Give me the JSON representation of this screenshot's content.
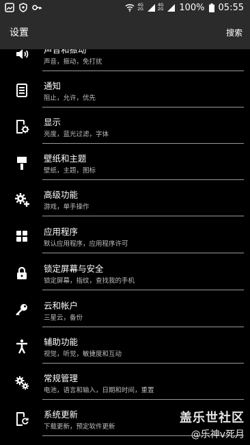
{
  "status_bar": {
    "network_top": "4G",
    "network_bottom": "2G",
    "network2_top": "4G",
    "network2_bottom": "2G",
    "battery": "100%",
    "time": "05:55"
  },
  "header": {
    "title": "设置",
    "search": "搜索"
  },
  "items": [
    {
      "title": "声音和振动",
      "subtitle": "声音，振动，免打扰",
      "icon": "speaker-icon"
    },
    {
      "title": "通知",
      "subtitle": "阻止，允许，优先",
      "icon": "notification-icon"
    },
    {
      "title": "显示",
      "subtitle": "亮度，蓝光过滤，字体",
      "icon": "display-settings-icon"
    },
    {
      "title": "壁纸和主题",
      "subtitle": "壁纸，主题，图标",
      "icon": "paint-roller-icon"
    },
    {
      "title": "高级功能",
      "subtitle": "游戏，单手操作",
      "icon": "gear-plus-icon"
    },
    {
      "title": "应用程序",
      "subtitle": "默认应用程序，应用程序许可",
      "icon": "apps-grid-icon"
    },
    {
      "title": "锁定屏幕与安全",
      "subtitle": "锁定屏幕，指纹，查找我的手机",
      "icon": "lock-icon"
    },
    {
      "title": "云和帐户",
      "subtitle": "三星云，备份",
      "icon": "key-icon"
    },
    {
      "title": "辅助功能",
      "subtitle": "视觉，听觉，敏捷度和互动",
      "icon": "accessibility-icon"
    },
    {
      "title": "常规管理",
      "subtitle": "电池，语言和输入，日期和时间，重置",
      "icon": "gears-icon"
    },
    {
      "title": "系统更新",
      "subtitle": "下载更新，预定软件更新",
      "icon": "system-update-icon"
    }
  ],
  "watermark": {
    "line1": "盖乐世社区",
    "line2": "@乐神v死月"
  }
}
